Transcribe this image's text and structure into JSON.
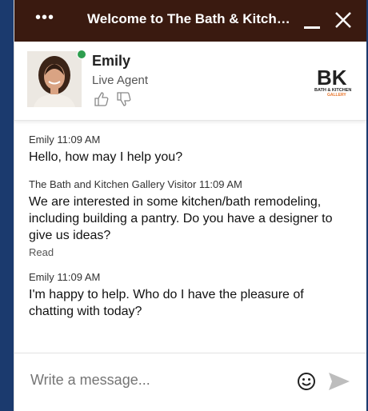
{
  "header": {
    "menu_label": "•••",
    "title": "Welcome to The Bath & Kitch…",
    "colors": {
      "titlebar": "#3a1a10",
      "accent": "#e8762b"
    }
  },
  "agent": {
    "name": "Emily",
    "role": "Live Agent",
    "status_color": "#2e9e4f",
    "logo_text": "BK",
    "logo_subtext": "BATH & KITCHEN",
    "logo_subtext2": "GALLERY"
  },
  "messages": [
    {
      "meta": "Emily 11:09 AM",
      "text": "Hello, how may I help you?"
    },
    {
      "meta": "The Bath and Kitchen Gallery Visitor 11:09 AM",
      "text": "We are interested in some kitchen/bath remodeling, including building a pantry. Do you have a designer to give us ideas?",
      "status": "Read"
    },
    {
      "meta": "Emily 11:09 AM",
      "text": "I'm happy to help. Who do I have the pleasure of chatting with today?"
    }
  ],
  "composer": {
    "placeholder": "Write a message...",
    "emoji_icon": "emoji-icon",
    "send_icon": "send-icon"
  }
}
